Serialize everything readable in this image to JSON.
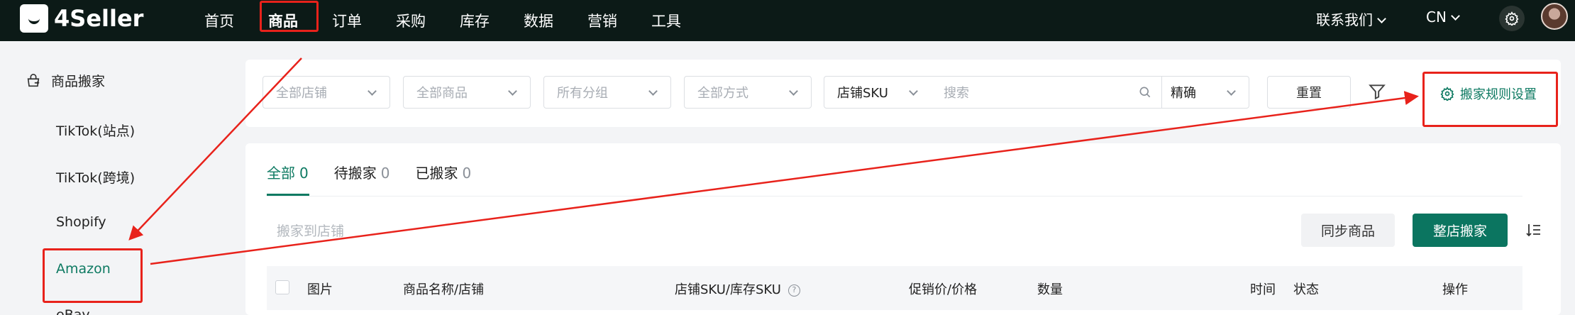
{
  "brand": {
    "name": "4Seller"
  },
  "nav": {
    "items": [
      "首页",
      "商品",
      "订单",
      "采购",
      "库存",
      "数据",
      "营销",
      "工具"
    ],
    "contact": "联系我们",
    "language": "CN"
  },
  "sidebar": {
    "section": "商品搬家",
    "items": [
      "TikTok(站点)",
      "TikTok(跨境)",
      "Shopify",
      "Amazon",
      "eBay"
    ],
    "active": "Amazon"
  },
  "filters": {
    "store": "全部店铺",
    "product": "全部商品",
    "group": "所有分组",
    "method": "全部方式",
    "sku_type": "店铺SKU",
    "search_placeholder": "搜索",
    "match": "精确",
    "reset": "重置",
    "rule_settings": "搬家规则设置"
  },
  "tabs": [
    {
      "label": "全部",
      "count": "0"
    },
    {
      "label": "待搬家",
      "count": "0"
    },
    {
      "label": "已搬家",
      "count": "0"
    }
  ],
  "toolbar": {
    "move_target_placeholder": "搬家到店铺",
    "sync": "同步商品",
    "store_move": "整店搬家"
  },
  "table": {
    "columns": [
      "图片",
      "商品名称/店铺",
      "店铺SKU/库存SKU",
      "促销价/价格",
      "数量",
      "时间",
      "状态",
      "操作"
    ]
  },
  "colors": {
    "nav_bg": "#0c1a17",
    "accent": "#0e7a62",
    "annotation": "#e8221b"
  }
}
